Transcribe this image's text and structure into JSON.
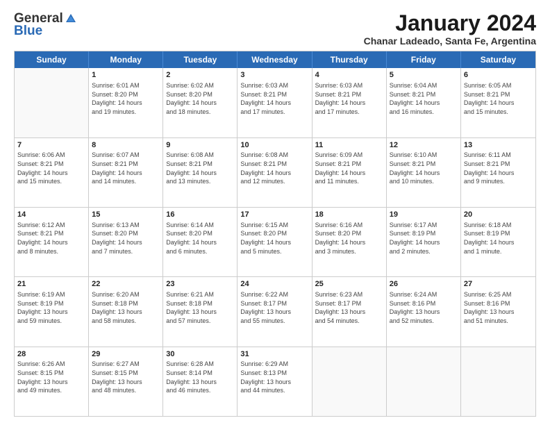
{
  "logo": {
    "general": "General",
    "blue": "Blue"
  },
  "title": "January 2024",
  "subtitle": "Chanar Ladeado, Santa Fe, Argentina",
  "days": [
    "Sunday",
    "Monday",
    "Tuesday",
    "Wednesday",
    "Thursday",
    "Friday",
    "Saturday"
  ],
  "weeks": [
    [
      {
        "day": "",
        "content": ""
      },
      {
        "day": "1",
        "content": "Sunrise: 6:01 AM\nSunset: 8:20 PM\nDaylight: 14 hours\nand 19 minutes."
      },
      {
        "day": "2",
        "content": "Sunrise: 6:02 AM\nSunset: 8:20 PM\nDaylight: 14 hours\nand 18 minutes."
      },
      {
        "day": "3",
        "content": "Sunrise: 6:03 AM\nSunset: 8:21 PM\nDaylight: 14 hours\nand 17 minutes."
      },
      {
        "day": "4",
        "content": "Sunrise: 6:03 AM\nSunset: 8:21 PM\nDaylight: 14 hours\nand 17 minutes."
      },
      {
        "day": "5",
        "content": "Sunrise: 6:04 AM\nSunset: 8:21 PM\nDaylight: 14 hours\nand 16 minutes."
      },
      {
        "day": "6",
        "content": "Sunrise: 6:05 AM\nSunset: 8:21 PM\nDaylight: 14 hours\nand 15 minutes."
      }
    ],
    [
      {
        "day": "7",
        "content": "Sunrise: 6:06 AM\nSunset: 8:21 PM\nDaylight: 14 hours\nand 15 minutes."
      },
      {
        "day": "8",
        "content": "Sunrise: 6:07 AM\nSunset: 8:21 PM\nDaylight: 14 hours\nand 14 minutes."
      },
      {
        "day": "9",
        "content": "Sunrise: 6:08 AM\nSunset: 8:21 PM\nDaylight: 14 hours\nand 13 minutes."
      },
      {
        "day": "10",
        "content": "Sunrise: 6:08 AM\nSunset: 8:21 PM\nDaylight: 14 hours\nand 12 minutes."
      },
      {
        "day": "11",
        "content": "Sunrise: 6:09 AM\nSunset: 8:21 PM\nDaylight: 14 hours\nand 11 minutes."
      },
      {
        "day": "12",
        "content": "Sunrise: 6:10 AM\nSunset: 8:21 PM\nDaylight: 14 hours\nand 10 minutes."
      },
      {
        "day": "13",
        "content": "Sunrise: 6:11 AM\nSunset: 8:21 PM\nDaylight: 14 hours\nand 9 minutes."
      }
    ],
    [
      {
        "day": "14",
        "content": "Sunrise: 6:12 AM\nSunset: 8:21 PM\nDaylight: 14 hours\nand 8 minutes."
      },
      {
        "day": "15",
        "content": "Sunrise: 6:13 AM\nSunset: 8:20 PM\nDaylight: 14 hours\nand 7 minutes."
      },
      {
        "day": "16",
        "content": "Sunrise: 6:14 AM\nSunset: 8:20 PM\nDaylight: 14 hours\nand 6 minutes."
      },
      {
        "day": "17",
        "content": "Sunrise: 6:15 AM\nSunset: 8:20 PM\nDaylight: 14 hours\nand 5 minutes."
      },
      {
        "day": "18",
        "content": "Sunrise: 6:16 AM\nSunset: 8:20 PM\nDaylight: 14 hours\nand 3 minutes."
      },
      {
        "day": "19",
        "content": "Sunrise: 6:17 AM\nSunset: 8:19 PM\nDaylight: 14 hours\nand 2 minutes."
      },
      {
        "day": "20",
        "content": "Sunrise: 6:18 AM\nSunset: 8:19 PM\nDaylight: 14 hours\nand 1 minute."
      }
    ],
    [
      {
        "day": "21",
        "content": "Sunrise: 6:19 AM\nSunset: 8:19 PM\nDaylight: 13 hours\nand 59 minutes."
      },
      {
        "day": "22",
        "content": "Sunrise: 6:20 AM\nSunset: 8:18 PM\nDaylight: 13 hours\nand 58 minutes."
      },
      {
        "day": "23",
        "content": "Sunrise: 6:21 AM\nSunset: 8:18 PM\nDaylight: 13 hours\nand 57 minutes."
      },
      {
        "day": "24",
        "content": "Sunrise: 6:22 AM\nSunset: 8:17 PM\nDaylight: 13 hours\nand 55 minutes."
      },
      {
        "day": "25",
        "content": "Sunrise: 6:23 AM\nSunset: 8:17 PM\nDaylight: 13 hours\nand 54 minutes."
      },
      {
        "day": "26",
        "content": "Sunrise: 6:24 AM\nSunset: 8:16 PM\nDaylight: 13 hours\nand 52 minutes."
      },
      {
        "day": "27",
        "content": "Sunrise: 6:25 AM\nSunset: 8:16 PM\nDaylight: 13 hours\nand 51 minutes."
      }
    ],
    [
      {
        "day": "28",
        "content": "Sunrise: 6:26 AM\nSunset: 8:15 PM\nDaylight: 13 hours\nand 49 minutes."
      },
      {
        "day": "29",
        "content": "Sunrise: 6:27 AM\nSunset: 8:15 PM\nDaylight: 13 hours\nand 48 minutes."
      },
      {
        "day": "30",
        "content": "Sunrise: 6:28 AM\nSunset: 8:14 PM\nDaylight: 13 hours\nand 46 minutes."
      },
      {
        "day": "31",
        "content": "Sunrise: 6:29 AM\nSunset: 8:13 PM\nDaylight: 13 hours\nand 44 minutes."
      },
      {
        "day": "",
        "content": ""
      },
      {
        "day": "",
        "content": ""
      },
      {
        "day": "",
        "content": ""
      }
    ]
  ]
}
